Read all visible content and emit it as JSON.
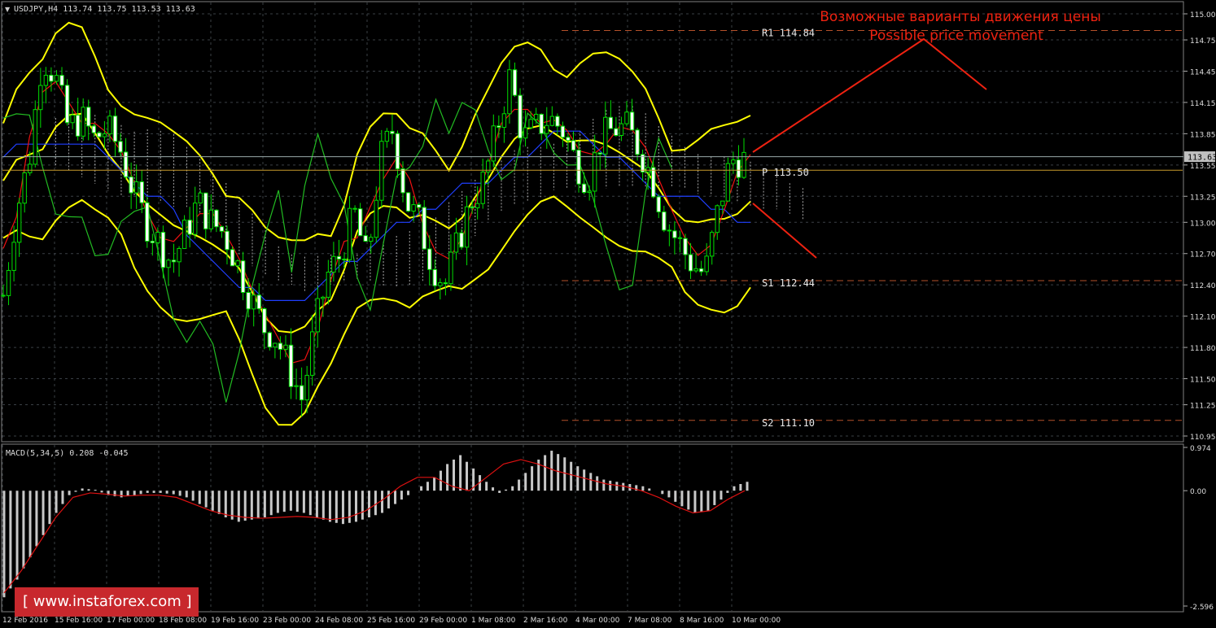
{
  "window": {
    "symbol_title": "USDJPY,H4  113.74 113.75 113.53 113.63",
    "macd_label": "MACD(5,34,5) 0.208 -0.045",
    "current_price_tag": "113.63"
  },
  "chart_data": {
    "type": "candlestick",
    "symbol": "USDJPY",
    "timeframe": "H4",
    "ohlc_header": {
      "open": 113.74,
      "high": 113.75,
      "low": 113.53,
      "close": 113.63
    },
    "ylim": [
      110.95,
      115.0
    ],
    "y_ticks": [
      "115.00",
      "114.75",
      "114.45",
      "114.15",
      "113.85",
      "113.55",
      "113.25",
      "113.00",
      "112.70",
      "112.40",
      "112.10",
      "111.80",
      "111.50",
      "111.25",
      "110.95"
    ],
    "x_ticks": [
      "12 Feb 2016",
      "15 Feb 16:00",
      "17 Feb 00:00",
      "18 Feb 08:00",
      "19 Feb 16:00",
      "23 Feb 00:00",
      "24 Feb 08:00",
      "25 Feb 16:00",
      "29 Feb 00:00",
      "1 Mar 08:00",
      "2 Mar 16:00",
      "4 Mar 00:00",
      "7 Mar 08:00",
      "8 Mar 16:00",
      "10 Mar 00:00"
    ],
    "close_path": [
      112.3,
      113.1,
      113.6,
      114.6,
      114.4,
      113.9,
      114.0,
      113.8,
      113.9,
      113.7,
      113.3,
      113.0,
      112.8,
      112.6,
      112.9,
      113.2,
      113.0,
      112.9,
      112.6,
      112.3,
      112.0,
      111.9,
      111.6,
      111.3,
      112.0,
      112.5,
      112.7,
      113.1,
      112.6,
      113.6,
      113.9,
      113.2,
      113.0,
      112.6,
      112.4,
      112.8,
      113.2,
      113.4,
      113.9,
      114.4,
      113.8,
      113.9,
      114.0,
      113.9,
      113.6,
      113.4,
      113.8,
      113.9,
      113.9,
      113.7,
      113.4,
      113.0,
      112.8,
      112.6,
      112.5,
      113.1,
      113.6,
      113.6
    ],
    "levels": [
      {
        "label": "R1 114.84",
        "value": 114.84
      },
      {
        "label": "P 113.50",
        "value": 113.5
      },
      {
        "label": "S1 112.44",
        "value": 112.44
      },
      {
        "label": "S2 111.10",
        "value": 111.1
      }
    ],
    "current_price": 113.63,
    "annotation": {
      "line1": "Возможные варианты движения цены",
      "line2": "Possible price movement"
    },
    "macd": {
      "ylim": [
        -2.596,
        0.974
      ],
      "y_ticks": [
        "0.974",
        "0.00",
        "-2.596"
      ],
      "histogram": [
        -2.4,
        -2.0,
        -1.5,
        -1.0,
        -0.5,
        -0.1,
        0.05,
        0.02,
        -0.1,
        -0.15,
        -0.1,
        -0.05,
        -0.05,
        -0.08,
        -0.15,
        -0.3,
        -0.45,
        -0.6,
        -0.7,
        -0.65,
        -0.6,
        -0.5,
        -0.45,
        -0.5,
        -0.6,
        -0.7,
        -0.75,
        -0.7,
        -0.6,
        -0.5,
        -0.3,
        -0.1,
        0.1,
        0.3,
        0.6,
        0.8,
        0.5,
        0.2,
        -0.05,
        0.1,
        0.4,
        0.7,
        0.9,
        0.75,
        0.55,
        0.4,
        0.25,
        0.2,
        0.15,
        0.1,
        0.0,
        -0.15,
        -0.35,
        -0.5,
        -0.45,
        -0.2,
        0.1,
        0.2
      ],
      "signal": [
        -2.3,
        -1.8,
        -1.2,
        -0.6,
        -0.15,
        -0.05,
        -0.08,
        -0.12,
        -0.1,
        -0.1,
        -0.15,
        -0.3,
        -0.45,
        -0.55,
        -0.6,
        -0.62,
        -0.6,
        -0.58,
        -0.6,
        -0.65,
        -0.6,
        -0.45,
        -0.2,
        0.1,
        0.3,
        0.3,
        0.1,
        0.0,
        0.3,
        0.6,
        0.7,
        0.6,
        0.45,
        0.35,
        0.25,
        0.15,
        0.1,
        0.0,
        -0.15,
        -0.35,
        -0.5,
        -0.45,
        -0.2,
        0.0
      ]
    }
  },
  "logo": {
    "text": "[  www.instaforex.com  ]"
  }
}
